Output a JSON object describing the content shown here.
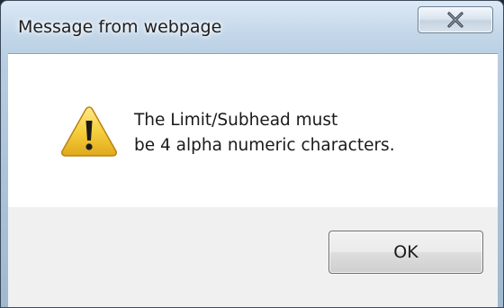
{
  "dialog": {
    "title": "Message from webpage",
    "close_icon": "close-icon",
    "icon": "warning-icon",
    "message_lines": [
      "The Limit/Subhead must",
      "be 4 alpha numeric characters."
    ],
    "ok_label": "OK"
  },
  "colors": {
    "icon_fill": "#f2c230",
    "close_glyph": "#3a4654",
    "content_bg": "#ffffff",
    "footer_bg": "#f0f0f0"
  }
}
